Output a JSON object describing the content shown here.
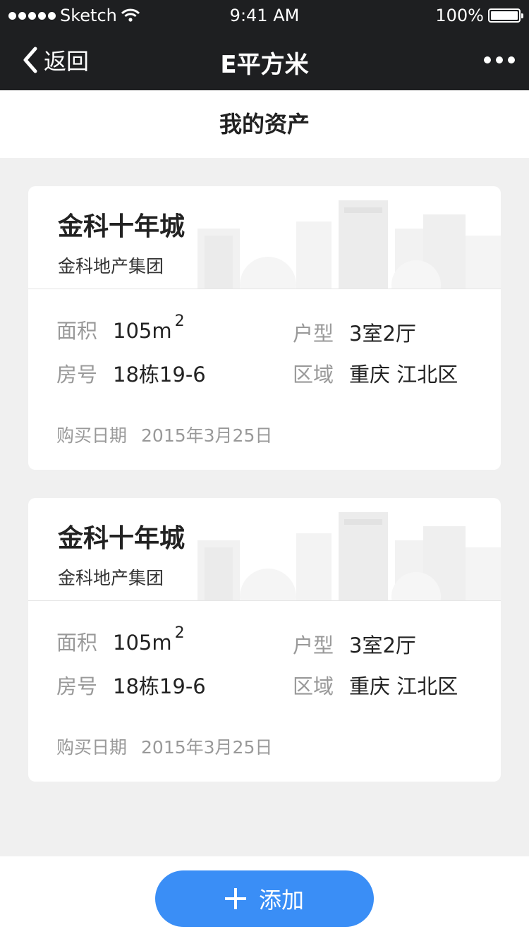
{
  "status_bar": {
    "carrier": "Sketch",
    "time": "9:41 AM",
    "battery": "100%"
  },
  "nav": {
    "back_label": "返回",
    "title": "E平方米"
  },
  "section_title": "我的资产",
  "labels": {
    "area": "面积",
    "layout": "户型",
    "room": "房号",
    "region": "区域",
    "purchase_date": "购买日期"
  },
  "assets": [
    {
      "name": "金科十年城",
      "developer": "金科地产集团",
      "area": "105m",
      "area_unit_sup": "2",
      "layout": "3室2厅",
      "room": "18栋19-6",
      "region": "重庆  江北区",
      "purchase_date": "2015年3月25日"
    },
    {
      "name": "金科十年城",
      "developer": "金科地产集团",
      "area": "105m",
      "area_unit_sup": "2",
      "layout": "3室2厅",
      "room": "18栋19-6",
      "region": "重庆  江北区",
      "purchase_date": "2015年3月25日"
    }
  ],
  "add_button_label": "添加",
  "colors": {
    "nav_bg": "#1e1f21",
    "accent": "#3a8ef6",
    "page_bg": "#f0f0f0"
  }
}
